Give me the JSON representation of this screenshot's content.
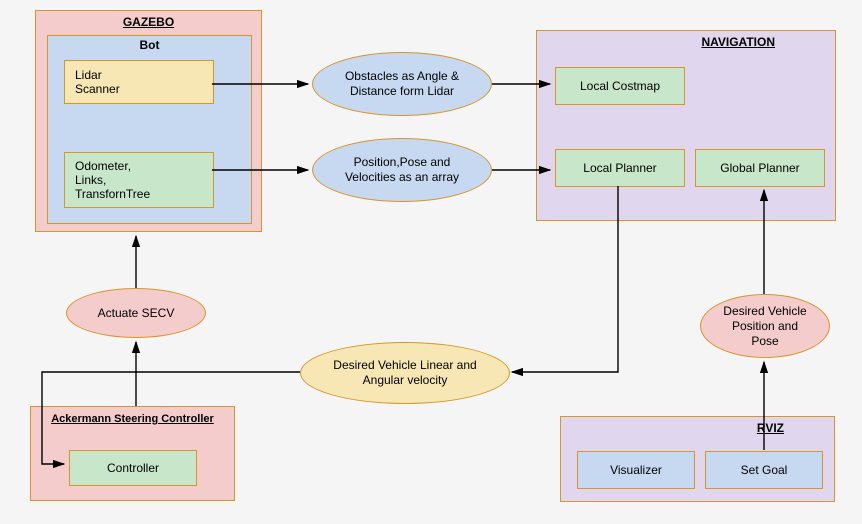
{
  "gazebo": {
    "title": "GAZEBO",
    "bot_title": "Bot",
    "lidar": "Lidar\nScanner",
    "odom": "Odometer,\nLinks,\nTransfornTree"
  },
  "navigation": {
    "title": "NAVIGATION",
    "local_costmap": "Local Costmap",
    "local_planner": "Local Planner",
    "global_planner": "Global Planner"
  },
  "ackermann": {
    "title": "Ackermann Steering Controller",
    "controller": "Controller"
  },
  "rviz": {
    "title": "RVIZ",
    "visualizer": "Visualizer",
    "set_goal": "Set Goal"
  },
  "ellipses": {
    "obstacles": "Obstacles as Angle & Distance form Lidar",
    "position": "Position,Pose and Velocities as an array",
    "actuate": "Actuate SECV",
    "desired_vel": "Desired Vehicle Linear and Angular velocity",
    "desired_pose": "Desired Vehicle Position and Pose"
  }
}
